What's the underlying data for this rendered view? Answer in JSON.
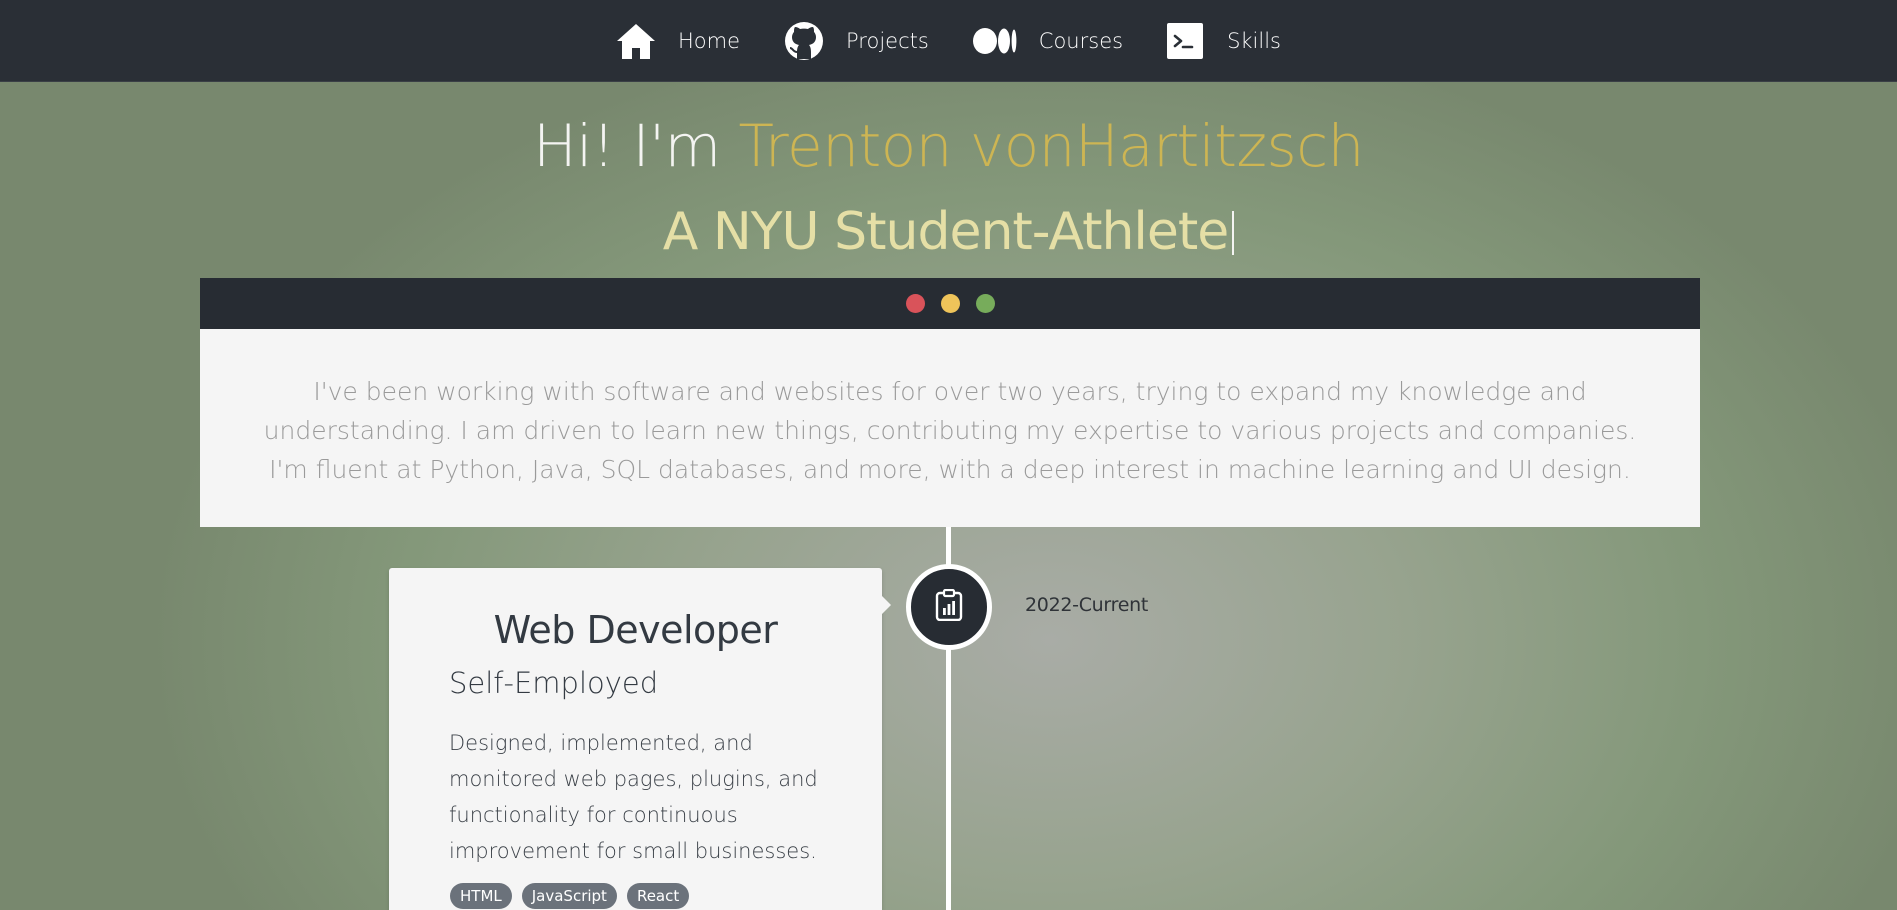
{
  "nav": {
    "items": [
      {
        "label": "Home",
        "icon": "home-icon"
      },
      {
        "label": "Projects",
        "icon": "github-icon"
      },
      {
        "label": "Courses",
        "icon": "medium-icon"
      },
      {
        "label": "Skills",
        "icon": "terminal-icon"
      }
    ]
  },
  "hero": {
    "greeting": "Hi! I'm",
    "name": "Trenton vonHartitzsch",
    "tagline": "A NYU Student-Athlete"
  },
  "terminal": {
    "dots": [
      "#d9535a",
      "#efc45a",
      "#77ac5b"
    ],
    "line1": "I've been working with software and websites for over two years, trying to expand my knowledge and understanding. I am driven to learn new things, contributing my expertise to various projects and companies.",
    "line2": "I'm fluent at Python, Java, SQL databases, and more, with a deep interest in machine learning and UI design."
  },
  "timeline": {
    "entries": [
      {
        "date": "2022-Current",
        "icon": "clipboard-chart-icon",
        "title": "Web Developer",
        "company": "Self-Employed",
        "description": "Designed, implemented, and monitored web pages, plugins, and functionality for continuous improvement for small businesses.",
        "tags": [
          "HTML",
          "JavaScript",
          "React"
        ]
      }
    ]
  },
  "colors": {
    "accent_name": "#cdb553",
    "tagline": "#e5dfa6",
    "nav_bg": "#2a2f36"
  }
}
